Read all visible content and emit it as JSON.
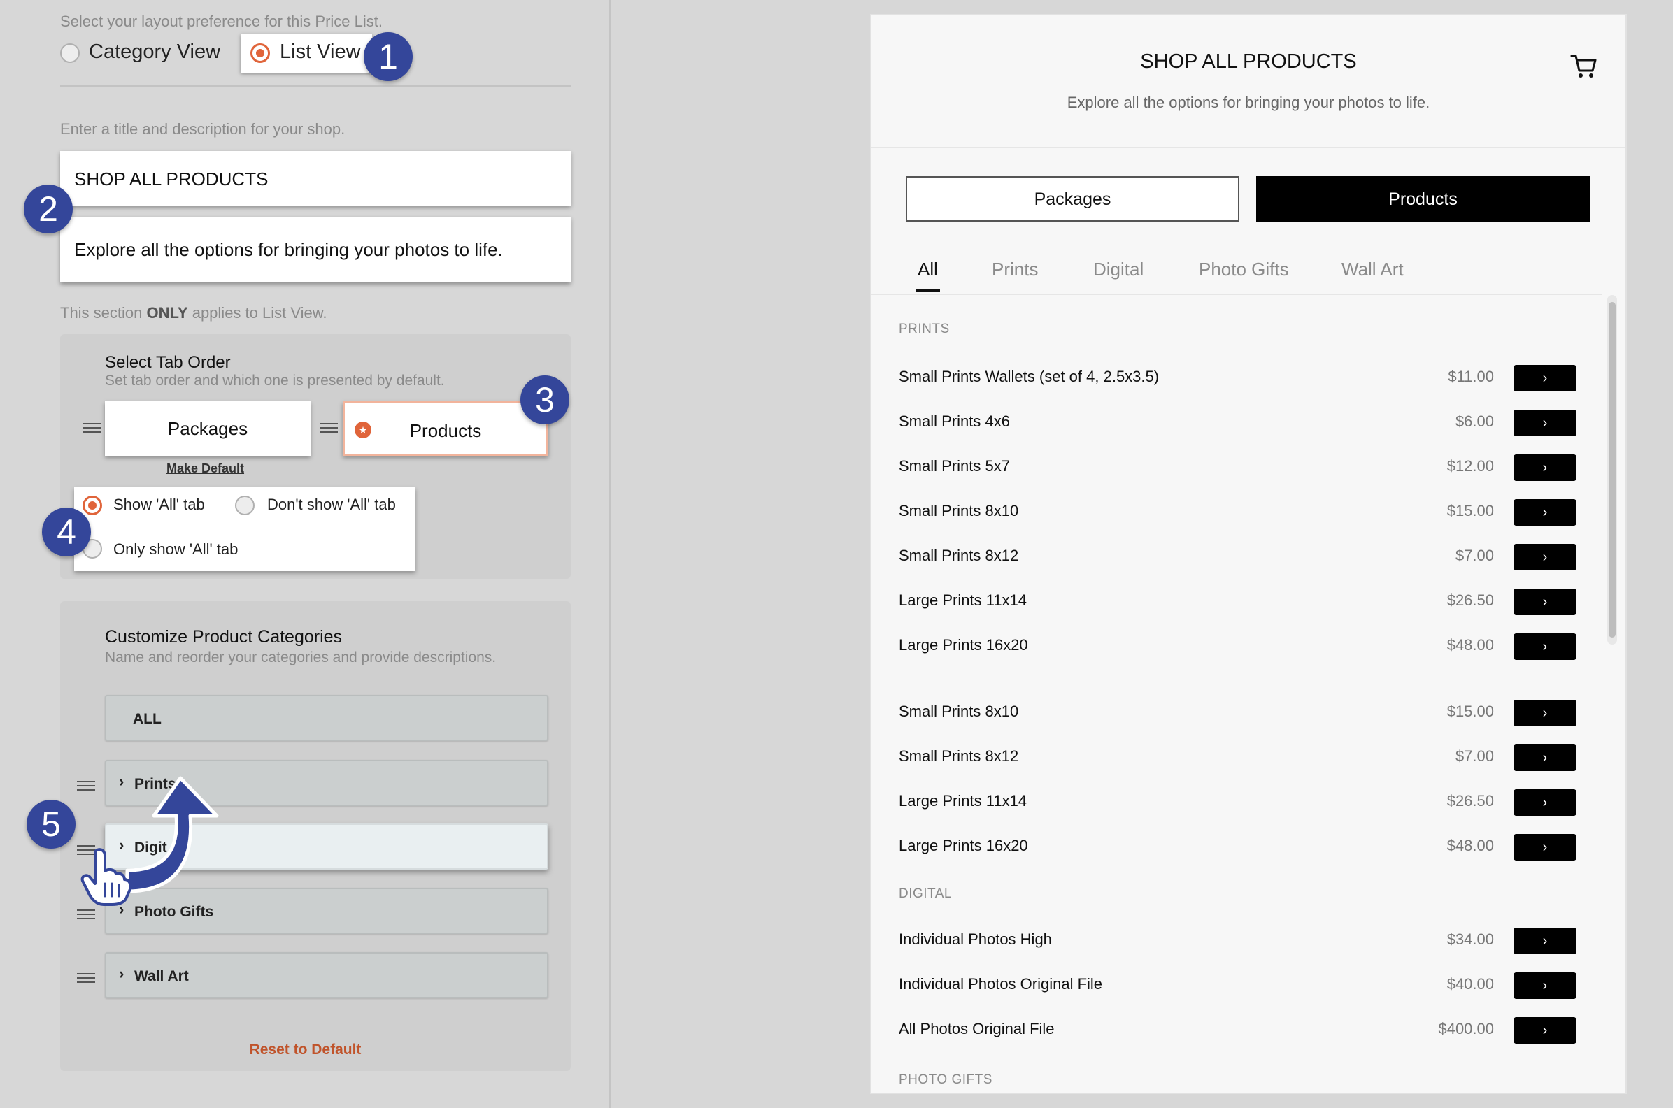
{
  "layout_section": {
    "hint": "Select your layout preference for this Price List.",
    "options": [
      "Category View",
      "List View"
    ],
    "selected": "List View"
  },
  "title_section": {
    "hint": "Enter a title and description for your shop.",
    "title_value": "SHOP ALL PRODUCTS",
    "description_value": "Explore all the options for bringing your photos to life."
  },
  "list_view_note": {
    "prefix": "This section ",
    "emphasis": "ONLY",
    "suffix": " applies to List View."
  },
  "tab_order": {
    "heading": "Select Tab Order",
    "subheading": "Set tab order and which one is presented by default.",
    "tabs": [
      "Packages",
      "Products"
    ],
    "default_tab": "Products",
    "make_default_label": "Make Default",
    "all_tab_options": [
      "Show 'All' tab",
      "Don't show 'All' tab",
      "Only show 'All' tab"
    ],
    "all_tab_selected": "Show 'All' tab"
  },
  "categories": {
    "heading": "Customize Product Categories",
    "subheading": "Name and reorder your categories and provide descriptions.",
    "all_label": "ALL",
    "items": [
      "Prints",
      "Digit",
      "Photo Gifts",
      "Wall Art"
    ],
    "reset_label": "Reset to Default"
  },
  "markers": [
    "1",
    "2",
    "3",
    "4",
    "5"
  ],
  "preview": {
    "title": "SHOP ALL PRODUCTS",
    "description": "Explore all the options for bringing your photos to life.",
    "toggle": [
      "Packages",
      "Products"
    ],
    "toggle_active": "Products",
    "tabs": [
      "All",
      "Prints",
      "Digital",
      "Photo Gifts",
      "Wall Art"
    ],
    "active_tab": "All",
    "sections": [
      {
        "heading": "PRINTS",
        "rows": [
          {
            "name": "Small Prints Wallets (set of 4, 2.5x3.5)",
            "price": "$11.00"
          },
          {
            "name": "Small Prints 4x6",
            "price": "$6.00"
          },
          {
            "name": "Small Prints 5x7",
            "price": "$12.00"
          },
          {
            "name": "Small Prints 8x10",
            "price": "$15.00"
          },
          {
            "name": "Small Prints 8x12",
            "price": "$7.00"
          },
          {
            "name": "Large Prints 11x14",
            "price": "$26.50"
          },
          {
            "name": "Large Prints 16x20",
            "price": "$48.00"
          }
        ]
      },
      {
        "heading": "",
        "rows": [
          {
            "name": "Small Prints 8x10",
            "price": "$15.00"
          },
          {
            "name": "Small Prints 8x12",
            "price": "$7.00"
          },
          {
            "name": "Large Prints 11x14",
            "price": "$26.50"
          },
          {
            "name": "Large Prints 16x20",
            "price": "$48.00"
          }
        ]
      },
      {
        "heading": "DIGITAL",
        "rows": [
          {
            "name": "Individual Photos High",
            "price": "$34.00"
          },
          {
            "name": "Individual Photos Original File",
            "price": "$40.00"
          },
          {
            "name": "All Photos Original File",
            "price": "$400.00"
          }
        ]
      },
      {
        "heading": "PHOTO GIFTS",
        "rows": []
      }
    ],
    "row_button_glyph": "›",
    "cart_icon": "cart-icon"
  },
  "colors": {
    "accent": "#e0643a",
    "marker": "#34469a",
    "reset_link": "#c0532a",
    "button_black": "#000000"
  }
}
